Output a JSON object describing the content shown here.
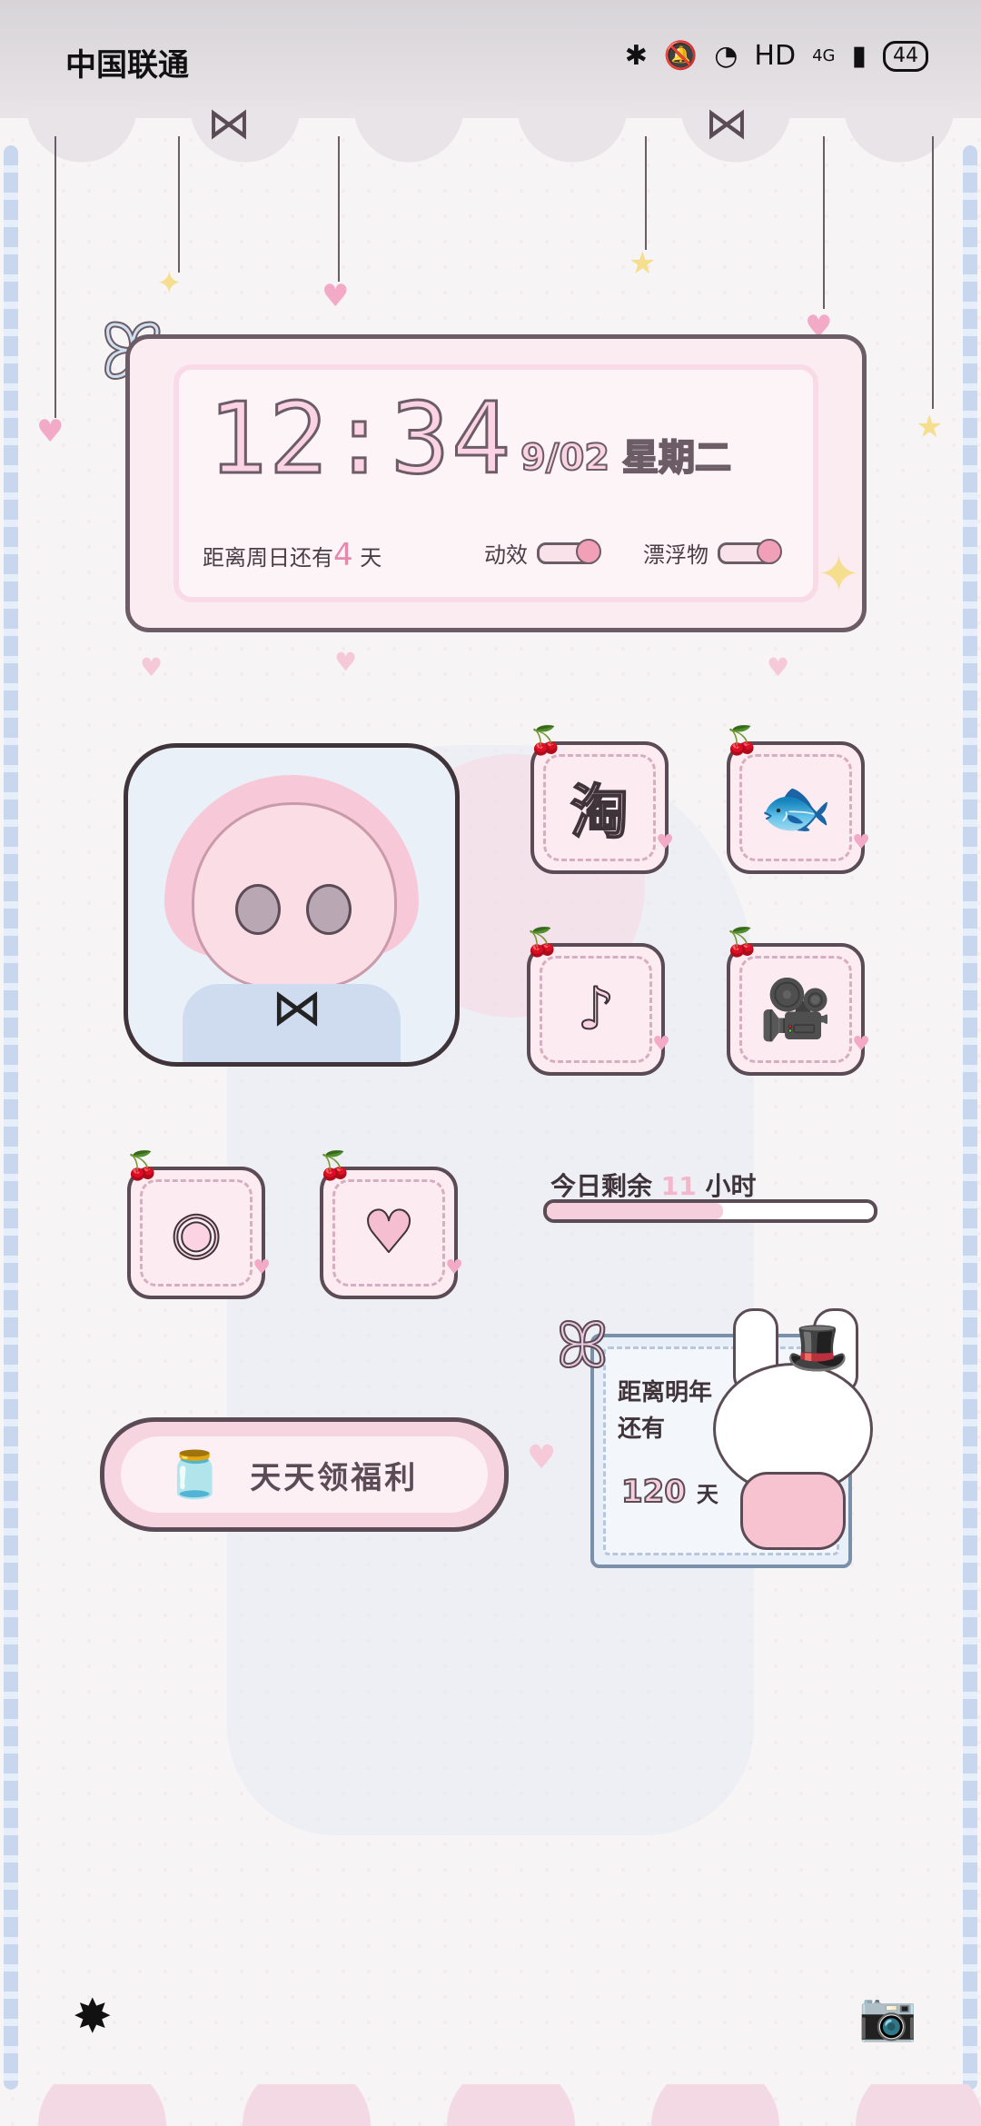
{
  "status_bar": {
    "carrier": "中国联通",
    "bluetooth_icon": "bluetooth-icon",
    "mute_icon": "mute-icon",
    "wifi_icon": "wifi-icon",
    "hd_label": "HD",
    "network_label": "4G",
    "battery": "44"
  },
  "clock_widget": {
    "time": "12:34",
    "date": "9/02 星期二",
    "countdown_prefix": "距离周日还有",
    "countdown_days": "4",
    "countdown_suffix": "天",
    "effects_label": "动效",
    "floaters_label": "漂浮物"
  },
  "apps": [
    {
      "name": "taobao",
      "glyph": "淘"
    },
    {
      "name": "jd",
      "glyph": "🐟"
    },
    {
      "name": "douyin",
      "glyph": "♪"
    },
    {
      "name": "video",
      "glyph": "🎥"
    },
    {
      "name": "camera-eye",
      "glyph": "◉"
    },
    {
      "name": "heart-wings",
      "glyph": "♥"
    }
  ],
  "today_remaining": {
    "prefix": "今日剩余",
    "hours": "11",
    "suffix": "小时",
    "progress": 0.54
  },
  "welfare_button": {
    "label": "天天领福利"
  },
  "new_year_card": {
    "line1": "距离明年",
    "line2": "还有",
    "days": "120",
    "unit": "天"
  },
  "bottom": {
    "left_icon": "sparkle-icon",
    "right_icon": "camera-icon"
  },
  "colors": {
    "accent_pink": "#f6cfdc",
    "outline": "#5b4b55",
    "frame_blue": "#c9d7ee"
  }
}
